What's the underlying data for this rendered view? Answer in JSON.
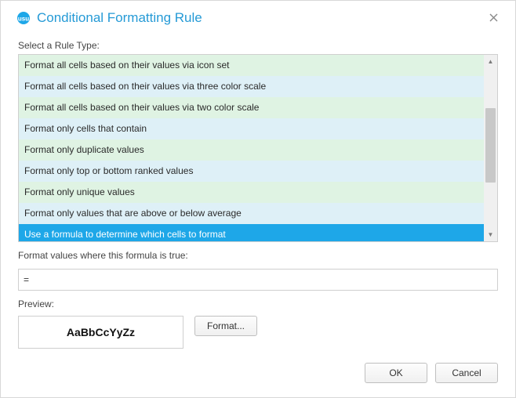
{
  "titlebar": {
    "title": "Conditional Formatting Rule"
  },
  "selectLabel": "Select a Rule Type:",
  "ruleTypes": [
    {
      "label": "Format all cells based on their values via icon set",
      "tone": "green",
      "selected": false
    },
    {
      "label": "Format all cells based on their values via three color scale",
      "tone": "blue",
      "selected": false
    },
    {
      "label": "Format all cells based on their values via two color scale",
      "tone": "green",
      "selected": false
    },
    {
      "label": "Format only cells that contain",
      "tone": "blue",
      "selected": false
    },
    {
      "label": "Format only duplicate values",
      "tone": "green",
      "selected": false
    },
    {
      "label": "Format only top or bottom ranked values",
      "tone": "blue",
      "selected": false
    },
    {
      "label": "Format only unique values",
      "tone": "green",
      "selected": false
    },
    {
      "label": "Format only values that are above or below average",
      "tone": "blue",
      "selected": false
    },
    {
      "label": "Use a formula to determine which cells to format",
      "tone": "selected",
      "selected": true
    }
  ],
  "formulaLabel": "Format values where this formula is true:",
  "formulaValue": "=",
  "previewLabel": "Preview:",
  "previewSample": "AaBbCcYyZz",
  "buttons": {
    "format": "Format...",
    "ok": "OK",
    "cancel": "Cancel"
  }
}
